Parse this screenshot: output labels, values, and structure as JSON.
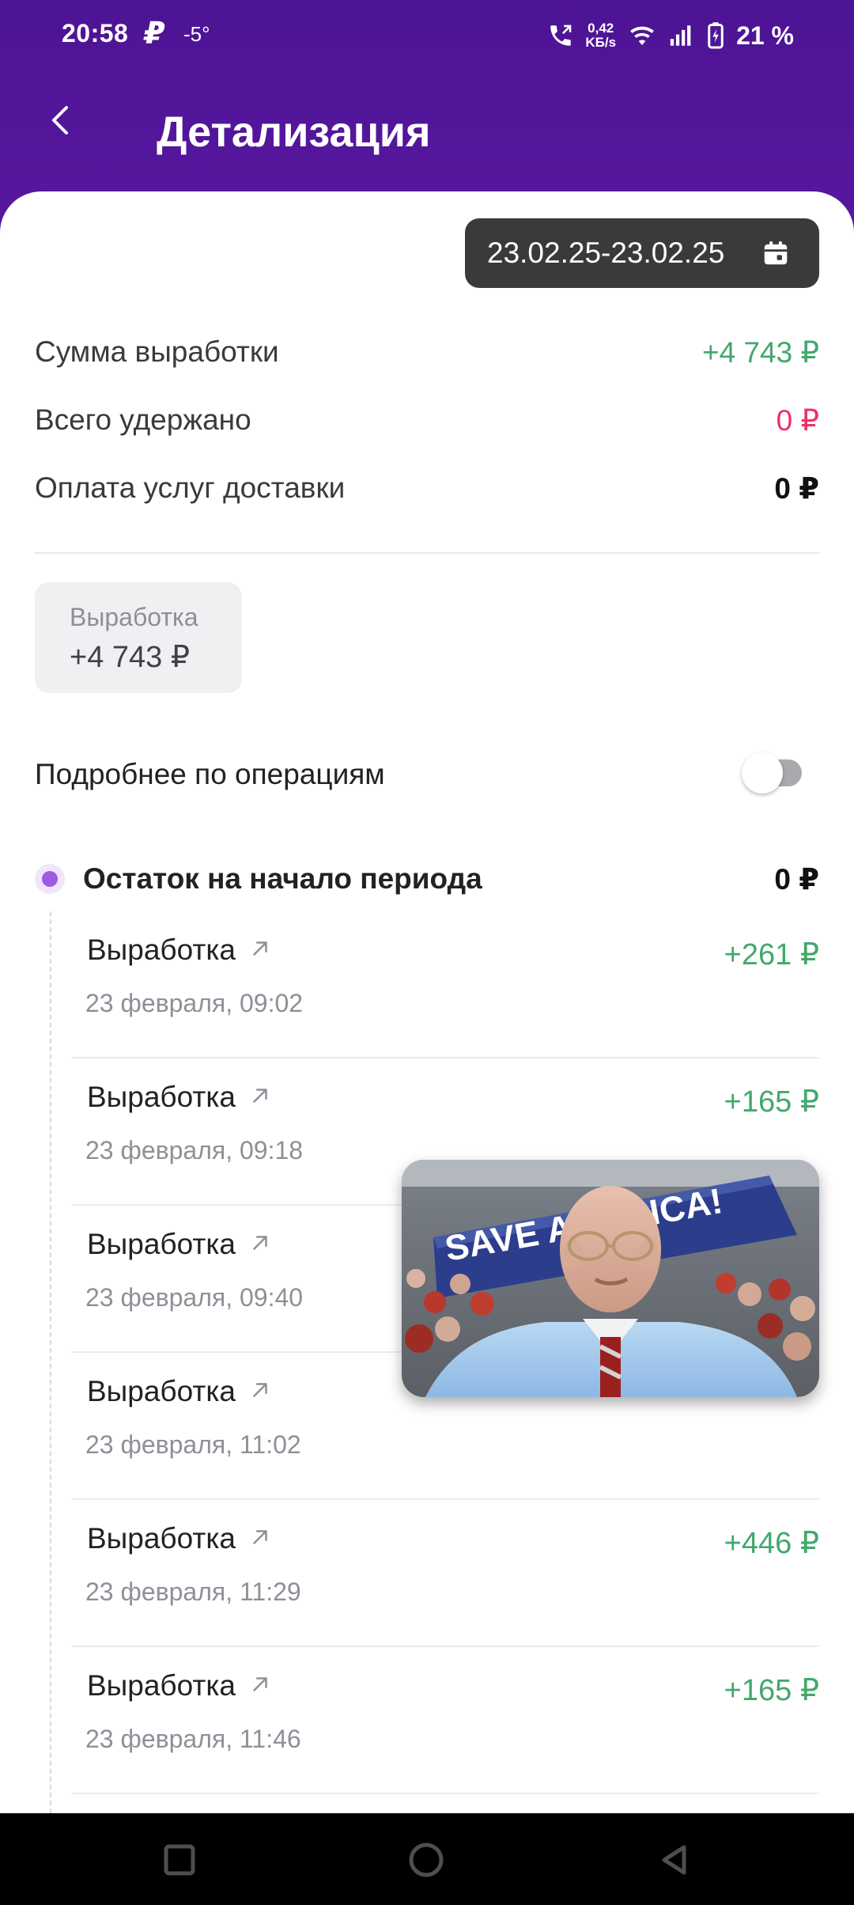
{
  "status_bar": {
    "time": "20:58",
    "app_icon_glyph": "₽",
    "temperature": "-5°",
    "net_speed_value": "0,42",
    "net_speed_unit": "KБ/s",
    "battery": "21 %"
  },
  "header": {
    "title": "Детализация"
  },
  "date_filter": {
    "range": "23.02.25-23.02.25"
  },
  "summary": [
    {
      "label": "Сумма выработки",
      "value": "+4 743 ₽",
      "tone": "green"
    },
    {
      "label": "Всего удержано",
      "value": "0 ₽",
      "tone": "red"
    },
    {
      "label": "Оплата услуг доставки",
      "value": "0 ₽",
      "tone": "bold"
    }
  ],
  "earn_card": {
    "label": "Выработка",
    "value": "+4 743 ₽"
  },
  "details": {
    "label": "Подробнее по операциям",
    "toggle_on": false
  },
  "timeline": {
    "start_label": "Остаток на начало периода",
    "start_value": "0 ₽"
  },
  "operations": [
    {
      "title": "Выработка",
      "date": "23 февраля, 09:02",
      "amount": "+261 ₽"
    },
    {
      "title": "Выработка",
      "date": "23 февраля, 09:18",
      "amount": "+165 ₽"
    },
    {
      "title": "Выработка",
      "date": "23 февраля, 09:40",
      "amount": ""
    },
    {
      "title": "Выработка",
      "date": "23 февраля, 11:02",
      "amount": ""
    },
    {
      "title": "Выработка",
      "date": "23 февраля, 11:29",
      "amount": "+446 ₽"
    },
    {
      "title": "Выработка",
      "date": "23 февраля, 11:46",
      "amount": "+165 ₽"
    }
  ],
  "pip_video": {
    "banner_text": "SAVE AMERICA!"
  },
  "colors": {
    "brand_purple": "#58179f",
    "positive_green": "#42a86c",
    "negative_red": "#ee2f66",
    "pill_dark": "#3a3a3a"
  },
  "icons": {
    "back": "back-arrow-icon",
    "calendar": "calendar-icon",
    "operation_link": "arrow-up-right-icon",
    "nav_recent": "square-icon",
    "nav_home": "circle-icon",
    "nav_back": "triangle-icon"
  }
}
